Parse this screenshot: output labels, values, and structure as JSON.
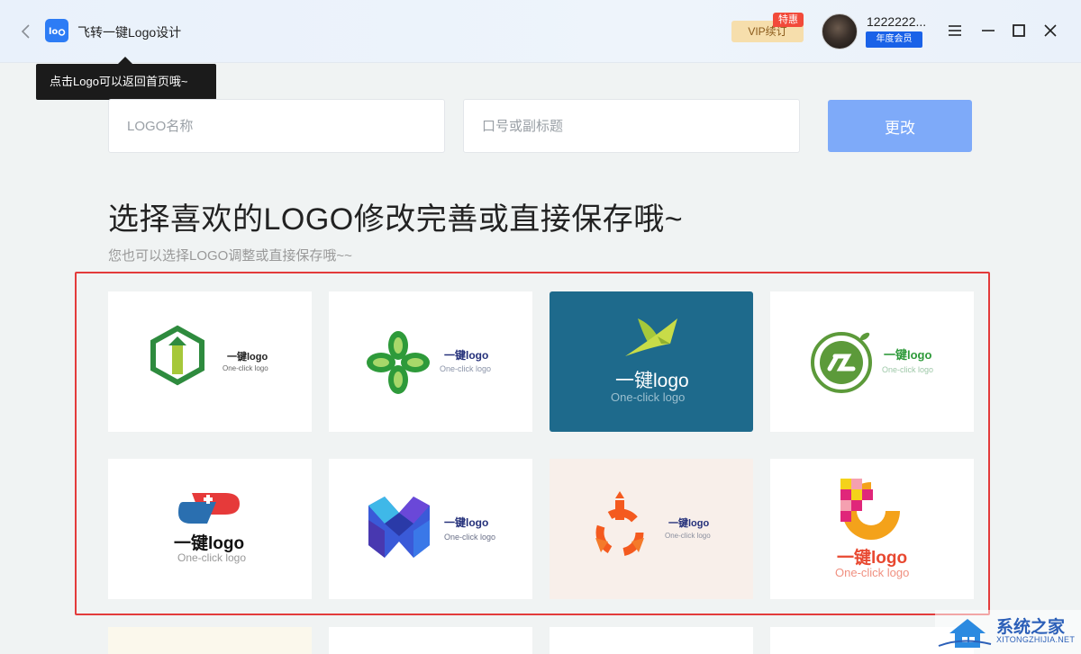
{
  "app": {
    "title": "飞转一键Logo设计"
  },
  "header": {
    "vip_label": "VIP续订",
    "vip_badge": "特惠",
    "username": "1222222...",
    "member_badge": "年度会员"
  },
  "tooltip": {
    "text": "点击Logo可以返回首页哦~"
  },
  "form": {
    "name_placeholder": "LOGO名称",
    "subtitle_placeholder": "口号或副标题",
    "change_label": "更改"
  },
  "heading": "选择喜欢的LOGO修改完善或直接保存哦~",
  "subheading": "您也可以选择LOGO调整或直接保存哦~~",
  "cards": [
    {
      "main": "一键logo",
      "sub": "One-click logo"
    },
    {
      "main": "一键logo",
      "sub": "One-click logo"
    },
    {
      "main": "一键logo",
      "sub": "One-click logo"
    },
    {
      "main": "一键logo",
      "sub": "One-click logo"
    },
    {
      "main": "一键logo",
      "sub": "One-click logo"
    },
    {
      "main": "一键logo",
      "sub": "One-click logo"
    },
    {
      "main": "一键logo",
      "sub": "One-click logo"
    },
    {
      "main": "一键logo",
      "sub": "One-click logo"
    }
  ],
  "watermark": {
    "title": "系统之家",
    "sub": "XITONGZHIJIA.NET"
  },
  "colors": {
    "accent": "#2d7cf5",
    "button": "#7eaaf9",
    "selection_frame": "#e33b3b"
  }
}
